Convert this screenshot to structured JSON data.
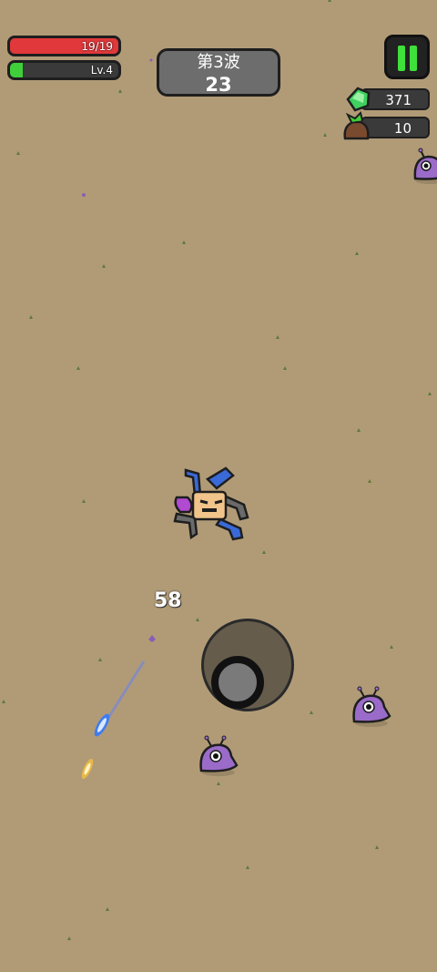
{
  "hud": {
    "hp_text": "19/19",
    "hp_fraction": 1.0,
    "level_text": "Lv.4",
    "xp_fraction": 0.12,
    "wave_label": "第3波",
    "wave_timer": "23",
    "gems": "371",
    "bags": "10"
  },
  "combat": {
    "damage_number": "58"
  },
  "icons": {
    "pause": "pause-icon",
    "gem": "gem-icon",
    "bag": "bag-icon"
  },
  "colors": {
    "ground": "#b19b77",
    "hp": "#e0383b",
    "xp": "#3fcf3a",
    "enemy": "#9b6bc9"
  }
}
